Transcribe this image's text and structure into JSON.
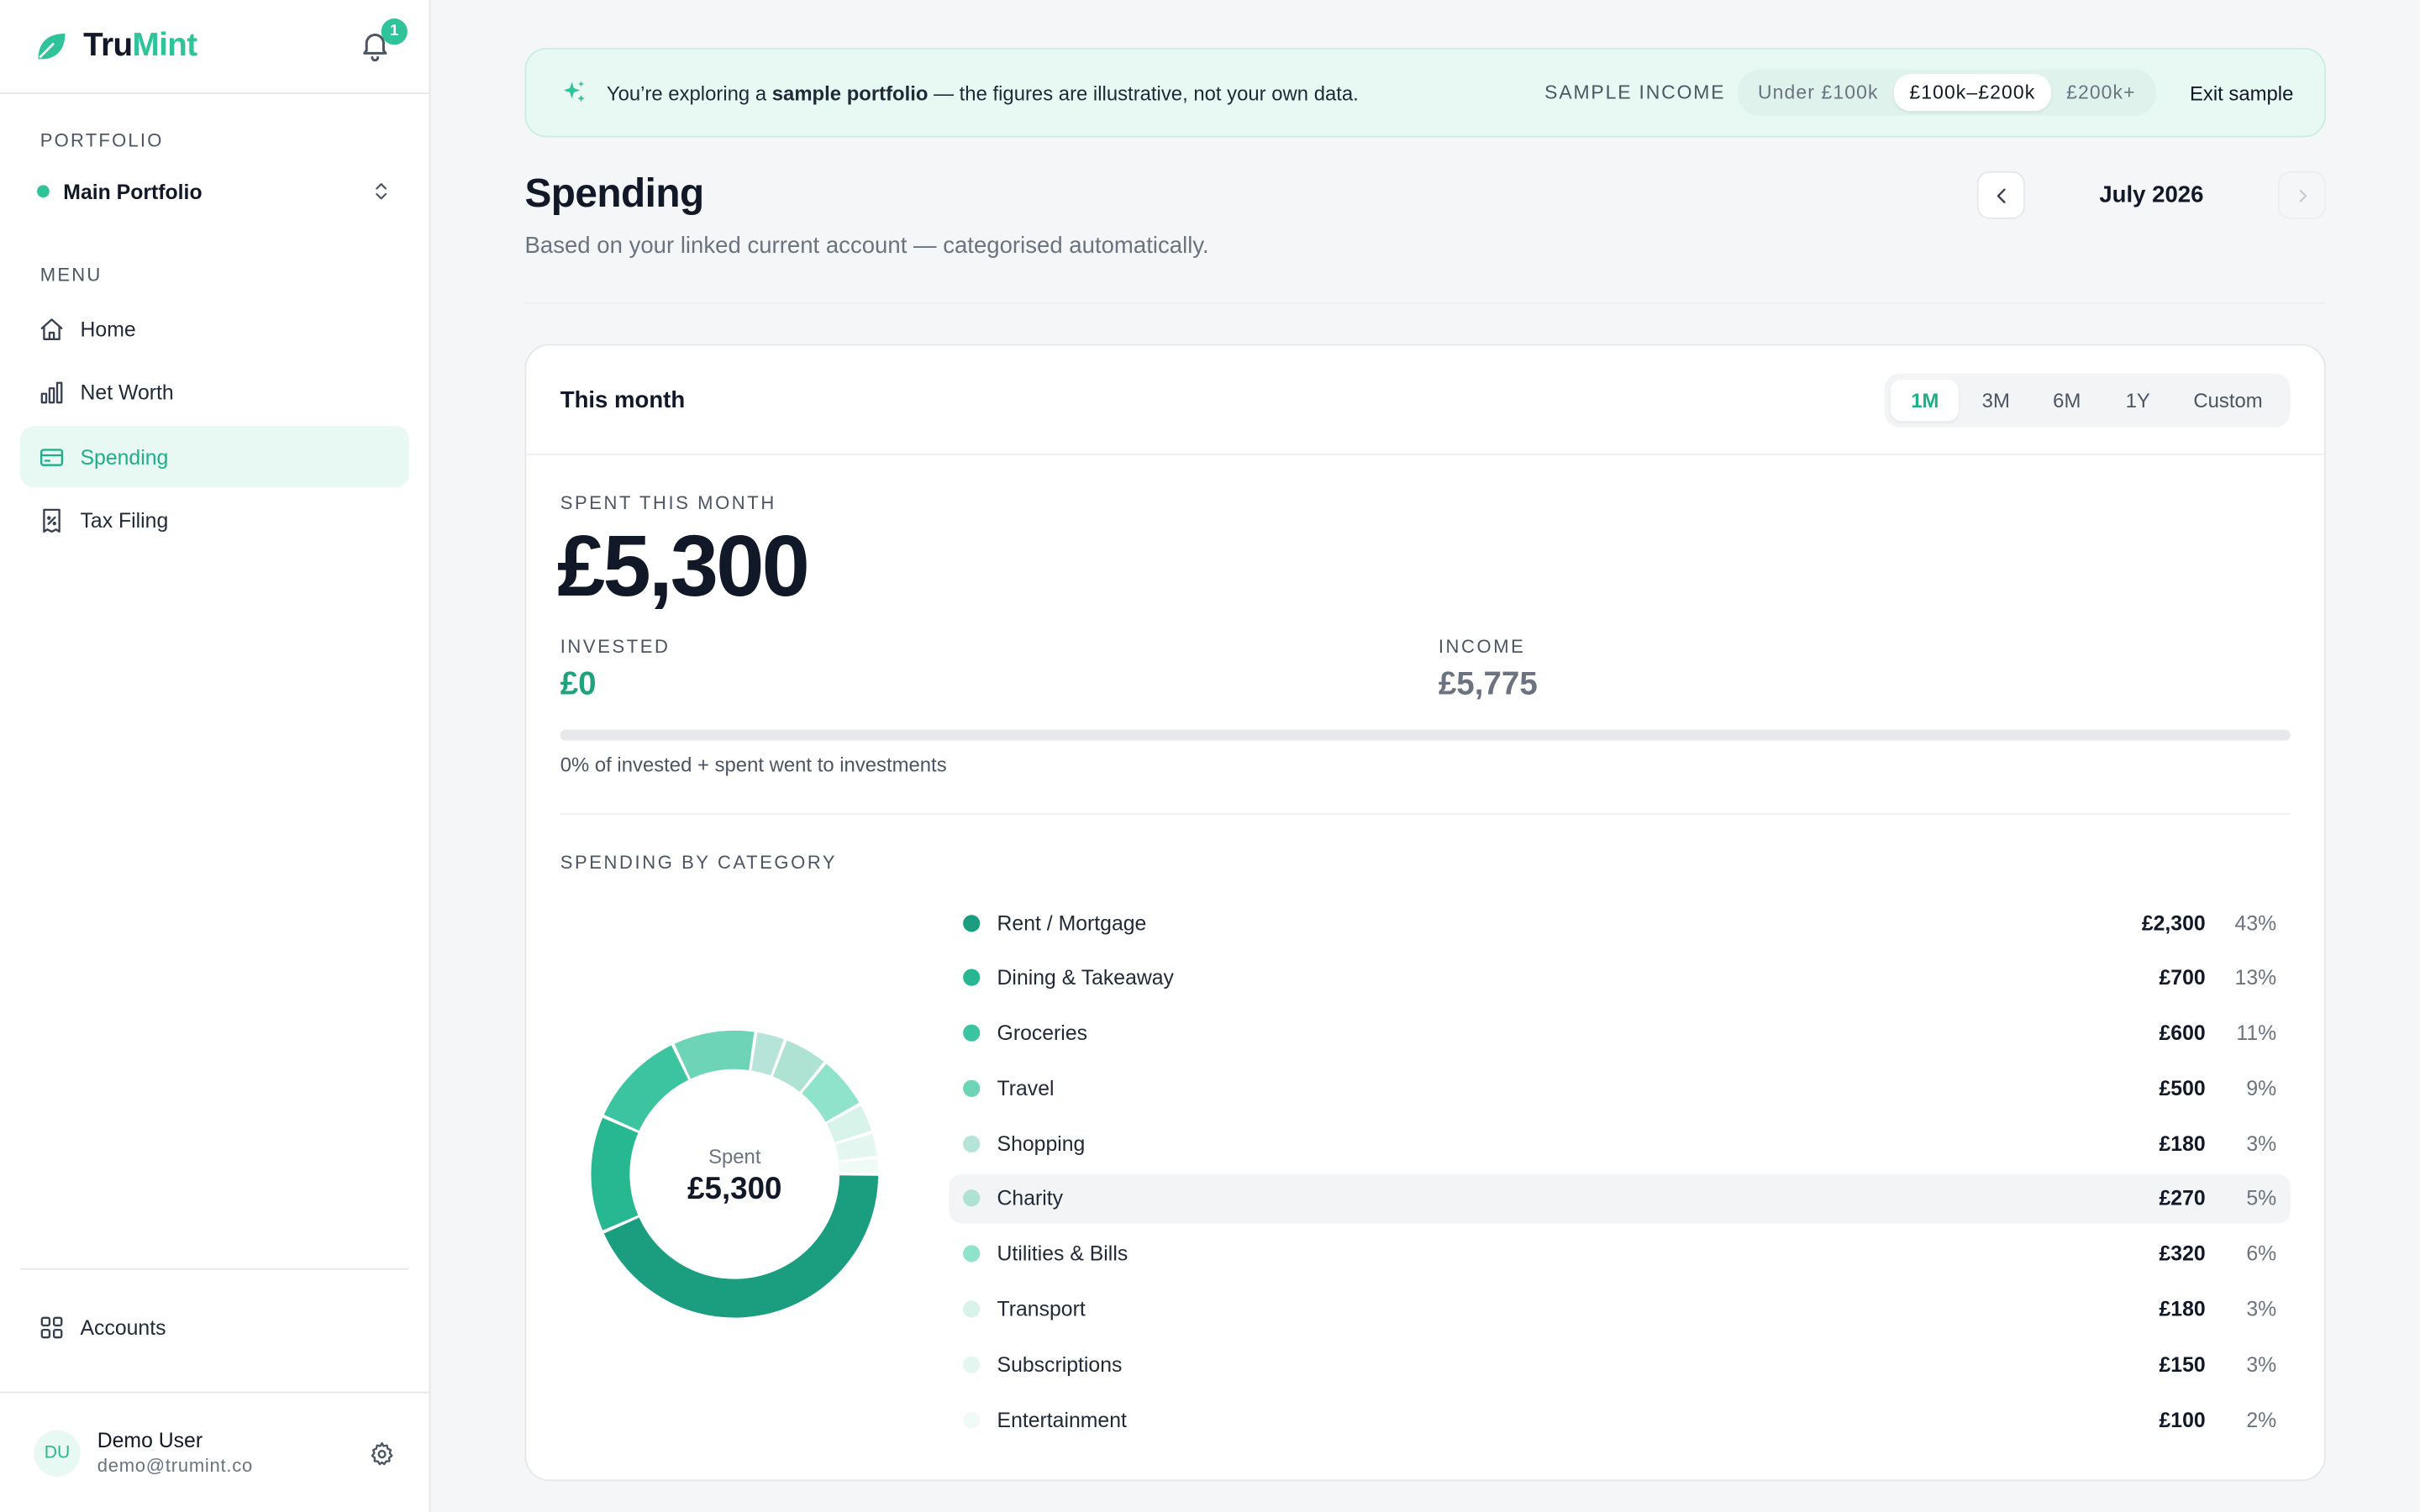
{
  "brand": {
    "name_part1": "Tru",
    "name_part2": "Mint",
    "notifications": "1"
  },
  "sidebar": {
    "portfolio_label": "PORTFOLIO",
    "portfolio_name": "Main Portfolio",
    "menu_label": "MENU",
    "items": [
      {
        "label": "Home",
        "icon": "home-icon"
      },
      {
        "label": "Net Worth",
        "icon": "bar-chart-icon"
      },
      {
        "label": "Spending",
        "icon": "card-icon",
        "active": true
      },
      {
        "label": "Tax Filing",
        "icon": "receipt-icon"
      }
    ],
    "accounts_label": "Accounts",
    "user": {
      "initials": "DU",
      "name": "Demo User",
      "email": "demo@trumint.co"
    }
  },
  "banner": {
    "text_pre": "You’re exploring a ",
    "text_bold": "sample portfolio",
    "text_post": " — the figures are illustrative, not your own data.",
    "income_label": "SAMPLE INCOME",
    "options": [
      "Under £100k",
      "£100k–£200k",
      "£200k+"
    ],
    "selected": "£100k–£200k",
    "exit_label": "Exit sample"
  },
  "header": {
    "title": "Spending",
    "subtitle": "Based on your linked current account — categorised automatically.",
    "month": "July 2026"
  },
  "card": {
    "title": "This month",
    "ranges": [
      "1M",
      "3M",
      "6M",
      "1Y",
      "Custom"
    ],
    "active_range": "1M",
    "spent_label": "SPENT THIS MONTH",
    "spent_value": "£5,300",
    "invested_label": "INVESTED",
    "invested_value": "£0",
    "income_label": "INCOME",
    "income_value": "£5,775",
    "invested_fraction": 0,
    "progress_note": "0% of invested + spent went to investments",
    "category_label": "SPENDING BY CATEGORY",
    "donut_label": "Spent",
    "donut_value": "£5,300"
  },
  "colors": {
    "accent": "#2fc39a",
    "invested": "#1fa37e",
    "income": "#6b7280"
  },
  "categories": [
    {
      "name": "Rent / Mortgage",
      "amount": "£2,300",
      "pct": "43%",
      "value": 2300,
      "color": "#1a9e7f"
    },
    {
      "name": "Dining & Takeaway",
      "amount": "£700",
      "pct": "13%",
      "value": 700,
      "color": "#27b892"
    },
    {
      "name": "Groceries",
      "amount": "£600",
      "pct": "11%",
      "value": 600,
      "color": "#3cc4a0"
    },
    {
      "name": "Travel",
      "amount": "£500",
      "pct": "9%",
      "value": 500,
      "color": "#6dd4b8"
    },
    {
      "name": "Shopping",
      "amount": "£180",
      "pct": "3%",
      "value": 180,
      "color": "#b7e4d8"
    },
    {
      "name": "Charity",
      "amount": "£270",
      "pct": "5%",
      "value": 270,
      "color": "#aee3d3"
    },
    {
      "name": "Utilities & Bills",
      "amount": "£320",
      "pct": "6%",
      "value": 320,
      "color": "#8fe3cb"
    },
    {
      "name": "Transport",
      "amount": "£180",
      "pct": "3%",
      "value": 180,
      "color": "#d7f3ea"
    },
    {
      "name": "Subscriptions",
      "amount": "£150",
      "pct": "3%",
      "value": 150,
      "color": "#e4f6f0"
    },
    {
      "name": "Entertainment",
      "amount": "£100",
      "pct": "2%",
      "value": 100,
      "color": "#f0faf6"
    }
  ]
}
